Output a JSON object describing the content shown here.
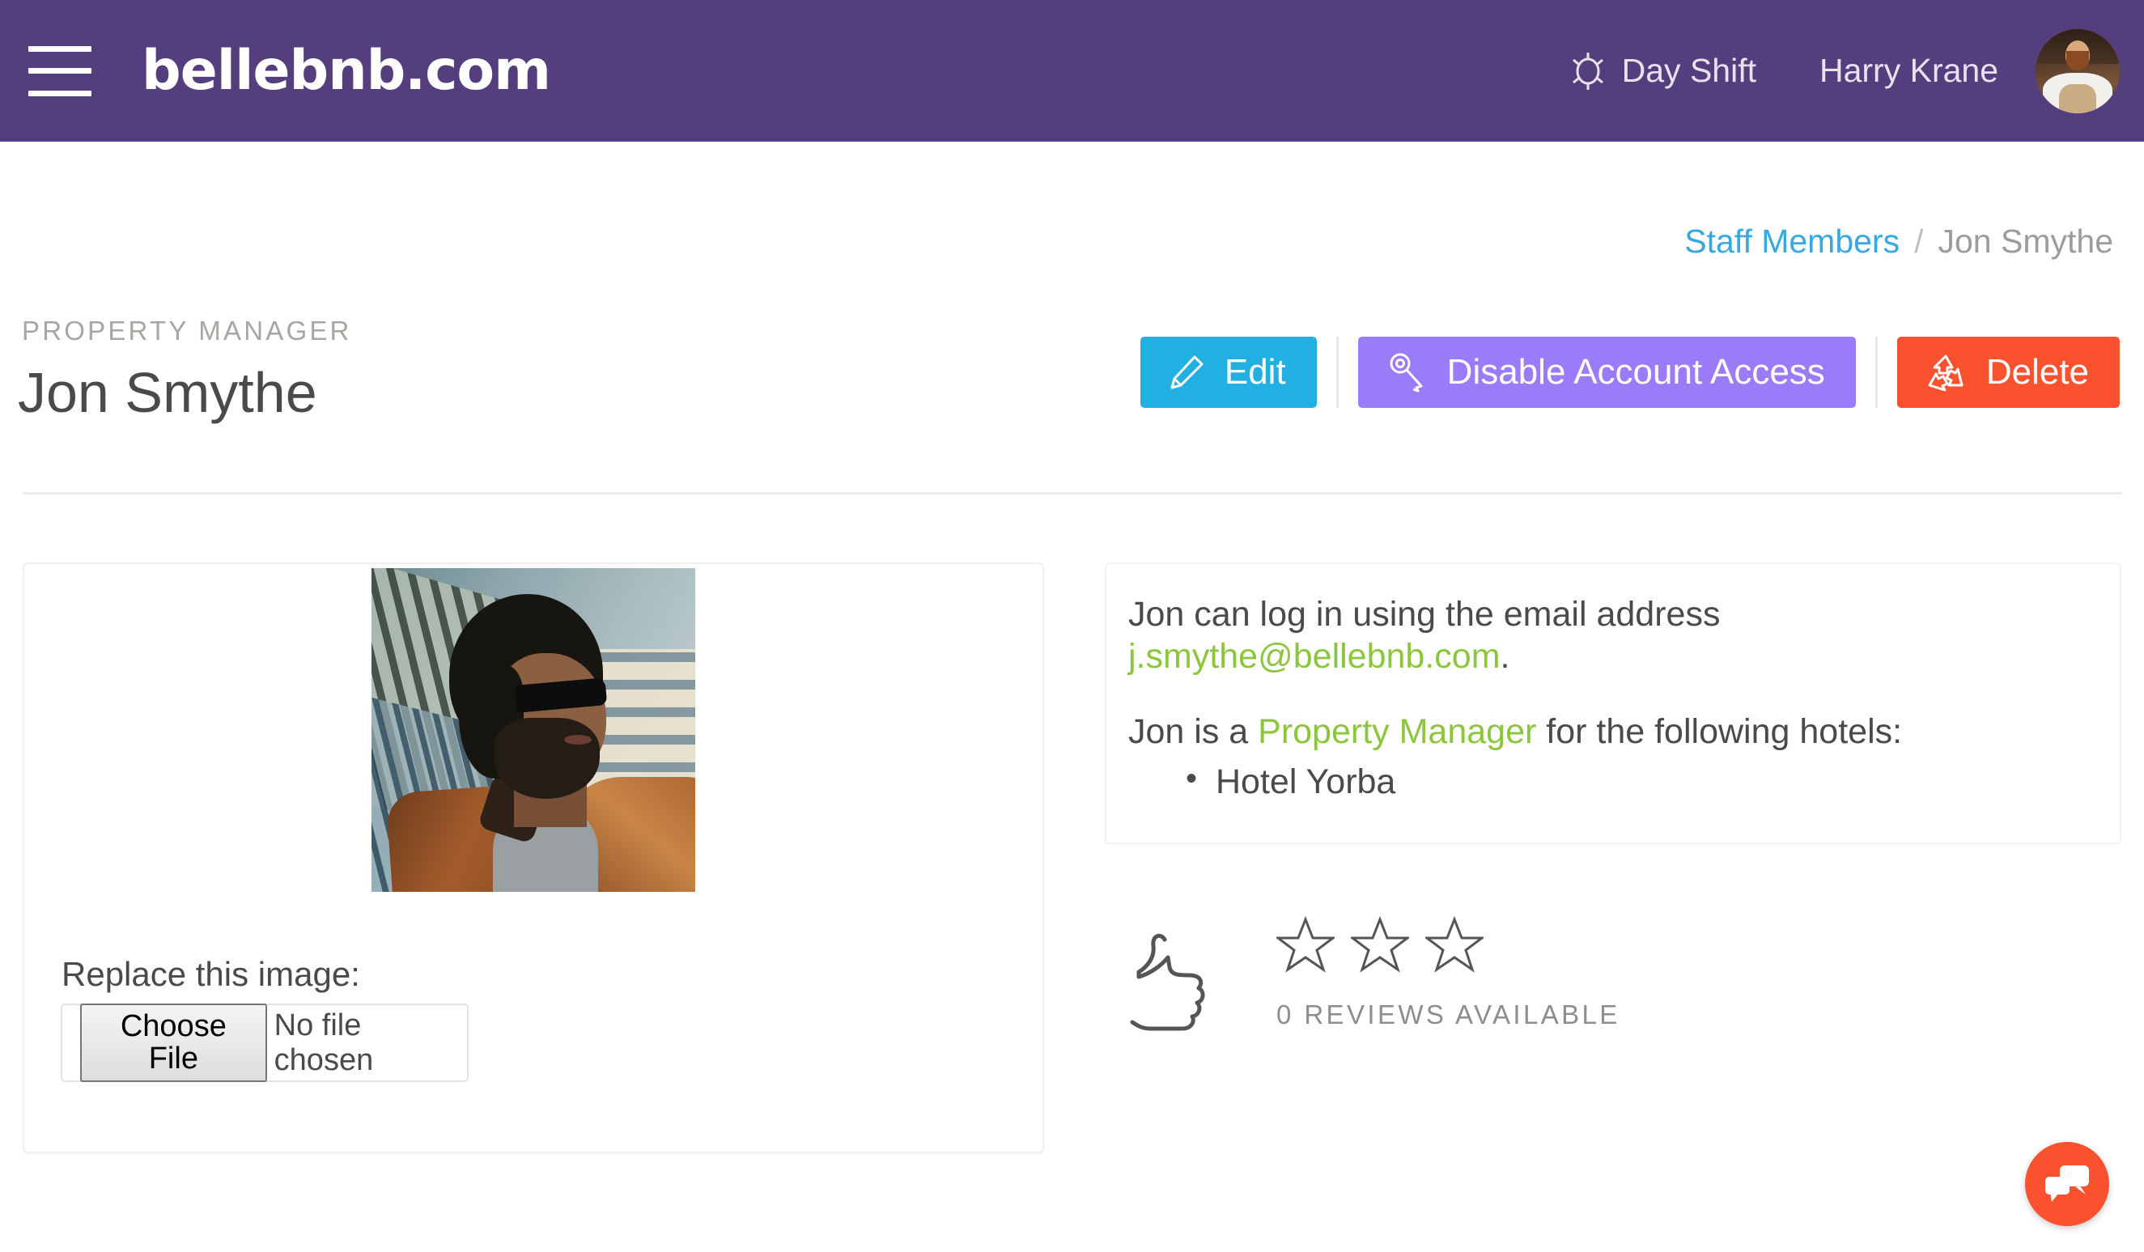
{
  "header": {
    "menu_icon": "hamburger-icon",
    "brand": "bellebnb.com",
    "shift_icon": "sun-icon",
    "shift_label": "Day Shift",
    "username": "Harry Krane",
    "avatar_icon": "user-avatar-photo",
    "background_color": "#543E7D"
  },
  "breadcrumb": {
    "parent": "Staff Members",
    "separator": "/",
    "current": "Jon Smythe",
    "link_color": "#37A9E0",
    "current_color": "#9C9C9C"
  },
  "page": {
    "eyebrow": "PROPERTY MANAGER",
    "title": "Jon Smythe"
  },
  "actions": {
    "edit": {
      "label": "Edit",
      "icon": "pencil-icon",
      "color": "#22B0E2"
    },
    "disable": {
      "label": "Disable Account Access",
      "icon": "key-icon",
      "color": "#9B7BF7"
    },
    "delete": {
      "label": "Delete",
      "icon": "recycle-icon",
      "color": "#FA512E"
    }
  },
  "profile_card": {
    "photo_alt": "staff-profile-photo",
    "replace_label": "Replace this image:",
    "file_button": "Choose File",
    "file_status": "No file chosen"
  },
  "info_card": {
    "line1_prefix": "Jon can log in using the email address",
    "email": "j.smythe@bellebnb.com",
    "line1_suffix": ".",
    "line2_prefix": "Jon is a ",
    "role": "Property Manager",
    "line2_suffix": " for the following hotels:",
    "hotels": [
      "Hotel Yorba"
    ],
    "link_color": "#8CC63E"
  },
  "reviews": {
    "thumb_icon": "thumbs-up-icon",
    "stars_total": 3,
    "stars_filled": 0,
    "count_label": "0 REVIEWS AVAILABLE"
  },
  "chat": {
    "icon": "chat-bubbles-icon",
    "color": "#FA512E"
  }
}
